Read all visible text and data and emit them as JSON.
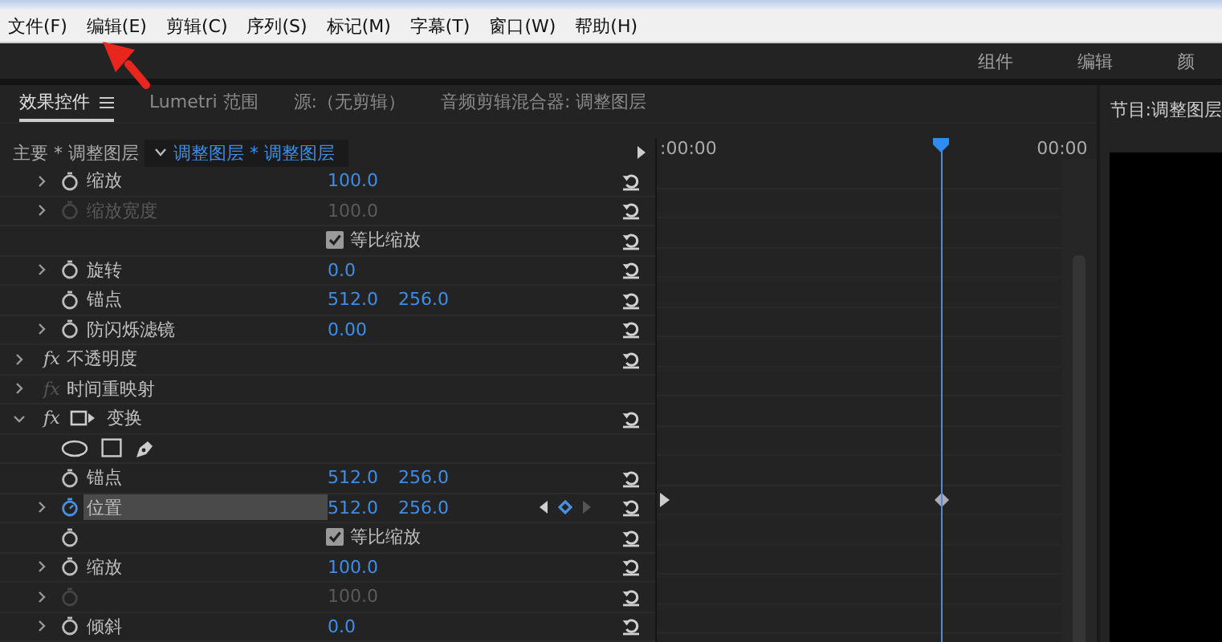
{
  "menu": [
    "文件(F)",
    "编辑(E)",
    "剪辑(C)",
    "序列(S)",
    "标记(M)",
    "字幕(T)",
    "窗口(W)",
    "帮助(H)"
  ],
  "workspaces": [
    {
      "label": "组件",
      "selected": false
    },
    {
      "label": "编辑",
      "selected": false
    },
    {
      "label": "颜",
      "selected": false
    }
  ],
  "panel_tabs": [
    {
      "label": "效果控件",
      "selected": true,
      "menu": true
    },
    {
      "label": "Lumetri 范围",
      "selected": false,
      "menu": false
    },
    {
      "label": "源:（无剪辑）",
      "selected": false,
      "menu": false
    },
    {
      "label": "音频剪辑混合器: 调整图层",
      "selected": false,
      "menu": false
    }
  ],
  "clip_bar": {
    "master": "主要 * 调整图层",
    "clip": "调整图层 * 调整图层"
  },
  "timeline": {
    "start": ":00:00",
    "end": "00:00"
  },
  "rows": [
    {
      "kind": "property",
      "label": "缩放",
      "values": [
        "100.0"
      ],
      "expandable": true,
      "expanded": false,
      "disabled": false,
      "selected": false,
      "animated": false,
      "reset": true,
      "keyframe": false
    },
    {
      "kind": "property",
      "label": "缩放宽度",
      "values": [
        "100.0"
      ],
      "expandable": true,
      "expanded": false,
      "disabled": true,
      "selected": false,
      "animated": false,
      "reset": true,
      "keyframe": false
    },
    {
      "kind": "checkbox",
      "label": "等比缩放",
      "checked": true,
      "stopwatch": false,
      "reset": true
    },
    {
      "kind": "property",
      "label": "旋转",
      "values": [
        "0.0"
      ],
      "expandable": true,
      "expanded": false,
      "disabled": false,
      "selected": false,
      "animated": false,
      "reset": true,
      "keyframe": false
    },
    {
      "kind": "property",
      "label": "锚点",
      "values": [
        "512.0",
        "256.0"
      ],
      "expandable": false,
      "expanded": false,
      "disabled": false,
      "selected": false,
      "animated": false,
      "reset": true,
      "keyframe": false
    },
    {
      "kind": "property",
      "label": "防闪烁滤镜",
      "values": [
        "0.00"
      ],
      "expandable": true,
      "expanded": false,
      "disabled": false,
      "selected": false,
      "animated": false,
      "reset": true,
      "keyframe": false
    },
    {
      "kind": "effect",
      "fx": "fx",
      "label": "不透明度",
      "enabled": true,
      "expanded": false,
      "motion_icon": false,
      "reset": true
    },
    {
      "kind": "effect",
      "fx": "fx",
      "label": "时间重映射",
      "enabled": false,
      "expanded": false,
      "motion_icon": false,
      "reset": false
    },
    {
      "kind": "effect",
      "fx": "fx",
      "label": "变换",
      "enabled": true,
      "expanded": true,
      "motion_icon": true,
      "reset": true
    },
    {
      "kind": "tools"
    },
    {
      "kind": "property",
      "label": "锚点",
      "values": [
        "512.0",
        "256.0"
      ],
      "expandable": false,
      "expanded": false,
      "disabled": false,
      "selected": false,
      "animated": false,
      "reset": true,
      "keyframe": false
    },
    {
      "kind": "property",
      "label": "位置",
      "values": [
        "512.0",
        "256.0"
      ],
      "expandable": true,
      "expanded": false,
      "disabled": false,
      "selected": true,
      "animated": true,
      "reset": true,
      "keyframe": true
    },
    {
      "kind": "checkbox",
      "label": "等比缩放",
      "checked": true,
      "stopwatch": true,
      "reset": true
    },
    {
      "kind": "property",
      "label": "缩放",
      "values": [
        "100.0"
      ],
      "expandable": true,
      "expanded": false,
      "disabled": false,
      "selected": false,
      "animated": false,
      "reset": true,
      "keyframe": false
    },
    {
      "kind": "property",
      "values": [
        "100.0"
      ],
      "expandable": true,
      "expanded": false,
      "disabled": true,
      "selected": false,
      "animated": false,
      "reset": true,
      "keyframe": false
    },
    {
      "kind": "property",
      "label": "倾斜",
      "values": [
        "0.0"
      ],
      "expandable": true,
      "expanded": false,
      "disabled": false,
      "selected": false,
      "animated": false,
      "reset": true,
      "keyframe": false
    }
  ],
  "program": {
    "title": "节目:调整图层"
  }
}
